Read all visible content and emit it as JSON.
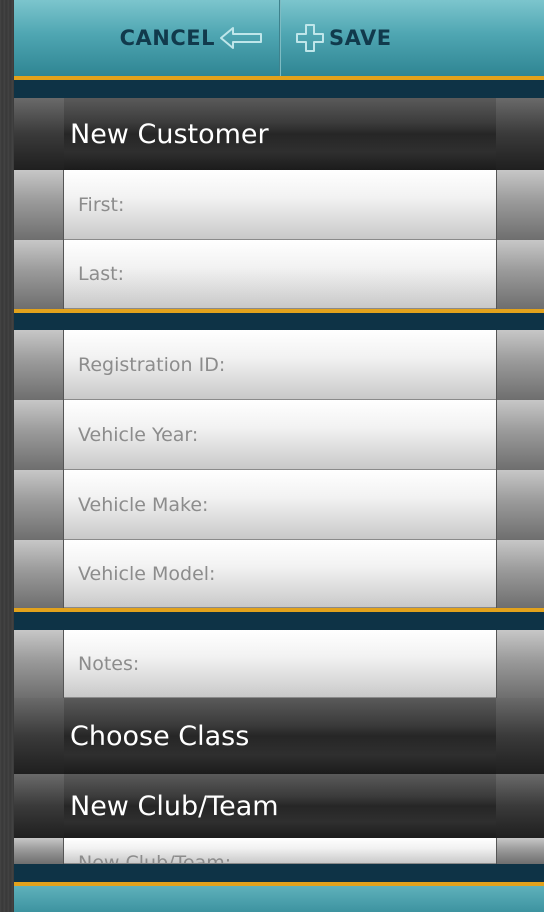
{
  "toolbar": {
    "cancel_label": "CANCEL",
    "save_label": "SAVE",
    "cancel_icon": "arrow-left-outline-icon",
    "save_icon": "plus-outline-icon"
  },
  "customer": {
    "header_label": "New Customer",
    "first_placeholder": "First:",
    "last_placeholder": "Last:"
  },
  "vehicle": {
    "registration_placeholder": "Registration ID:",
    "year_placeholder": "Vehicle Year:",
    "make_placeholder": "Vehicle Make:",
    "model_placeholder": "Vehicle Model:"
  },
  "extras": {
    "notes_placeholder": "Notes:",
    "choose_class_label": "Choose Class",
    "club_team_label": "New Club/Team",
    "club_team_field_placeholder": "New Club/Team:"
  },
  "colors": {
    "accent_teal": "#4fa6b2",
    "accent_gold": "#e2a21c",
    "navy": "#0e3346"
  }
}
